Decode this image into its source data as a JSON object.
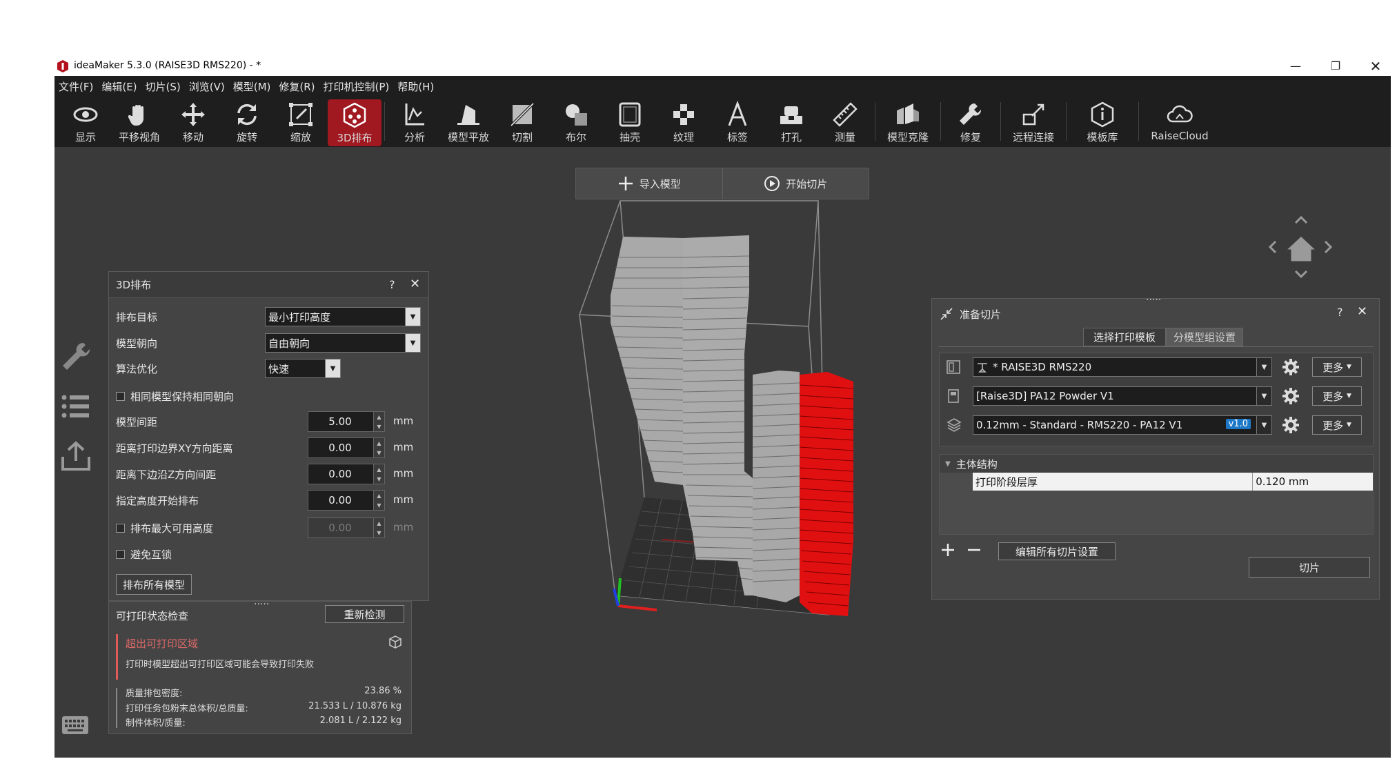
{
  "window": {
    "title": "ideaMaker 5.3.0 (RAISE3D RMS220) - *"
  },
  "menu": [
    "文件(F)",
    "编辑(E)",
    "切片(S)",
    "浏览(V)",
    "模型(M)",
    "修复(R)",
    "打印机控制(P)",
    "帮助(H)"
  ],
  "toolbar": [
    {
      "label": "显示",
      "icon": "eye-icon"
    },
    {
      "label": "平移视角",
      "icon": "hand-icon"
    },
    {
      "label": "移动",
      "icon": "move-icon"
    },
    {
      "label": "旋转",
      "icon": "rotate-icon"
    },
    {
      "label": "缩放",
      "icon": "scale-icon"
    },
    {
      "label": "3D排布",
      "icon": "arrange-3d-icon",
      "active": true
    },
    {
      "label": "分析",
      "icon": "analyze-icon"
    },
    {
      "label": "模型平放",
      "icon": "lay-flat-icon"
    },
    {
      "label": "切割",
      "icon": "cut-icon"
    },
    {
      "label": "布尔",
      "icon": "boolean-icon"
    },
    {
      "label": "抽壳",
      "icon": "hollow-icon"
    },
    {
      "label": "纹理",
      "icon": "texture-icon"
    },
    {
      "label": "标签",
      "icon": "label-icon"
    },
    {
      "label": "打孔",
      "icon": "punch-icon"
    },
    {
      "label": "测量",
      "icon": "ruler-icon"
    },
    {
      "label": "模型克隆",
      "icon": "clone-icon"
    },
    {
      "label": "修复",
      "icon": "repair-icon"
    },
    {
      "label": "远程连接",
      "icon": "remote-icon"
    },
    {
      "label": "模板库",
      "icon": "template-library-icon"
    },
    {
      "label": "RaiseCloud",
      "icon": "cloud-icon"
    }
  ],
  "viewport_top": {
    "import": "导入模型",
    "start_slice": "开始切片"
  },
  "arrange_panel": {
    "title": "3D排布",
    "help": "?",
    "target_label": "排布目标",
    "target_value": "最小打印高度",
    "orientation_label": "模型朝向",
    "orientation_value": "自由朝向",
    "algo_label": "算法优化",
    "algo_value": "快速",
    "same_orient_label": "相同模型保持相同朝向",
    "spacing_label": "模型间距",
    "spacing_value": "5.00",
    "xy_label": "距离打印边界XY方向距离",
    "xy_value": "0.00",
    "z_label": "距离下边沿Z方向间距",
    "z_value": "0.00",
    "start_height_label": "指定高度开始排布",
    "start_height_value": "0.00",
    "max_height_label": "排布最大可用高度",
    "max_height_value": "0.00",
    "avoid_interlock_label": "避免互锁",
    "unit": "mm",
    "arrange_all_button": "排布所有模型"
  },
  "check_panel": {
    "title": "可打印状态检查",
    "recheck_button": "重新检测",
    "warning_title": "超出可打印区域",
    "warning_desc": "打印时模型超出可打印区域可能会导致打印失败",
    "density_label": "质量排包密度:",
    "density_value": "23.86 %",
    "powder_label": "打印任务包粉末总体积/总质量:",
    "powder_value": "21.533 L / 10.876 kg",
    "part_label": "制件体积/质量:",
    "part_value": "2.081 L / 2.122 kg",
    "dots": "....."
  },
  "slice_panel": {
    "title": "准备切片",
    "help": "?",
    "dots": ".....",
    "tab_template": "选择打印模板",
    "tab_group": "分模型组设置",
    "printer_value": "* RAISE3D RMS220",
    "material_value": "[Raise3D] PA12 Powder V1",
    "profile_value": "0.12mm - Standard - RMS220 - PA12 V1",
    "profile_badge": "v1.0",
    "more": "更多",
    "section_title": "主体结构",
    "layer_label": "打印阶段层厚",
    "layer_value": "0.120 mm",
    "edit_all_button": "编辑所有切片设置",
    "slice_button": "切片"
  }
}
